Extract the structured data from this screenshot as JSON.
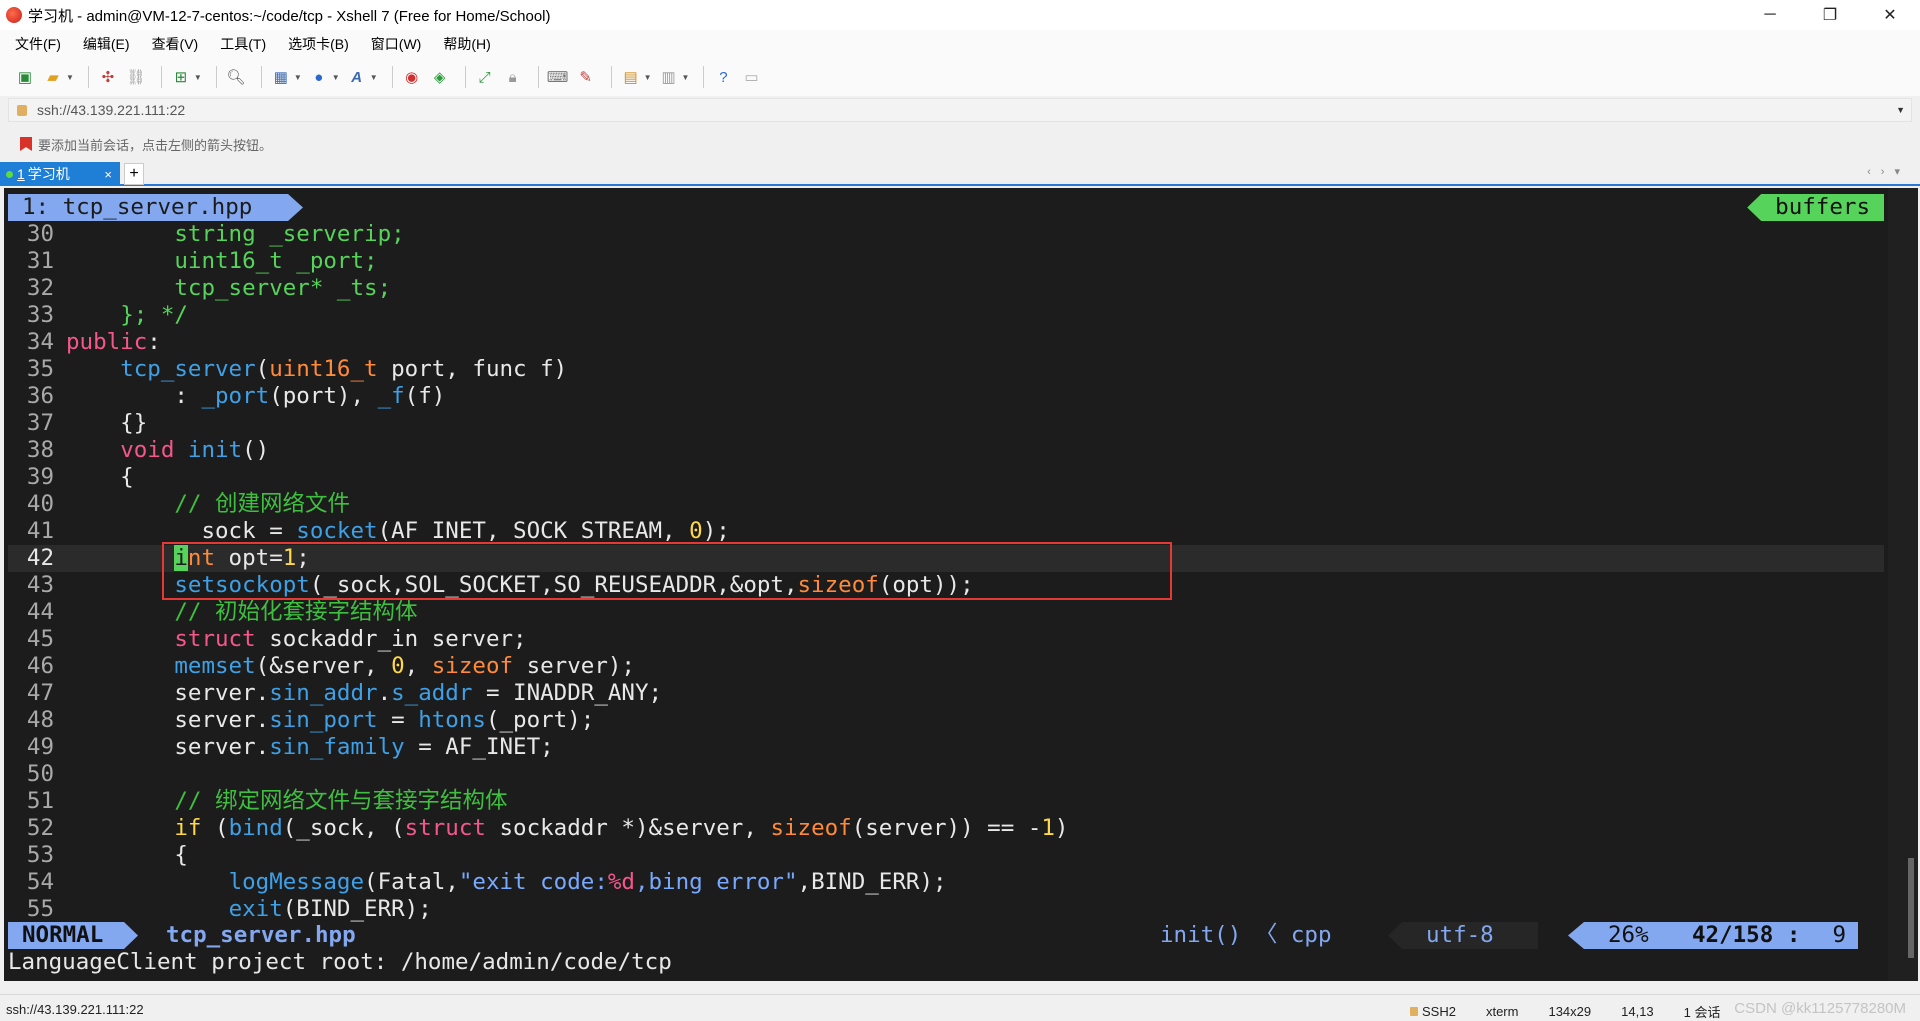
{
  "window": {
    "title": "学习机 - admin@VM-12-7-centos:~/code/tcp - Xshell 7 (Free for Home/School)",
    "minimize": "─",
    "maximize": "❐",
    "close": "✕"
  },
  "menu": [
    "文件(F)",
    "编辑(E)",
    "查看(V)",
    "工具(T)",
    "选项卡(B)",
    "窗口(W)",
    "帮助(H)"
  ],
  "address": {
    "value": "ssh://43.139.221.111:22"
  },
  "hint": {
    "text": "要添加当前会话，点击左侧的箭头按钮。"
  },
  "tab": {
    "number": "1",
    "label": "学习机",
    "close": "×",
    "add": "+"
  },
  "vim": {
    "buffer_file": "1: tcp_server.hpp",
    "buffer_tag": "buffers",
    "current_line": "42",
    "lines": [
      {
        "n": "30",
        "segs": [
          [
            "        ",
            ""
          ],
          [
            "string _serverip;",
            "green"
          ]
        ]
      },
      {
        "n": "31",
        "segs": [
          [
            "        ",
            ""
          ],
          [
            "uint16_t _port;",
            "green"
          ]
        ]
      },
      {
        "n": "32",
        "segs": [
          [
            "        ",
            ""
          ],
          [
            "tcp_server* _ts;",
            "green"
          ]
        ]
      },
      {
        "n": "33",
        "segs": [
          [
            "    ",
            ""
          ],
          [
            "}; */",
            "green"
          ]
        ]
      },
      {
        "n": "34",
        "segs": [
          [
            "public",
            "pink"
          ],
          [
            ":",
            ""
          ]
        ]
      },
      {
        "n": "35",
        "segs": [
          [
            "    ",
            ""
          ],
          [
            "tcp_server",
            "blue"
          ],
          [
            "(",
            ""
          ],
          [
            "uint16_t",
            "orange"
          ],
          [
            " port, func f)",
            ""
          ]
        ]
      },
      {
        "n": "36",
        "segs": [
          [
            "        : ",
            ""
          ],
          [
            "_port",
            "blue"
          ],
          [
            "(port), ",
            ""
          ],
          [
            "_f",
            "blue"
          ],
          [
            "(f)",
            ""
          ]
        ]
      },
      {
        "n": "37",
        "segs": [
          [
            "    {}",
            ""
          ]
        ]
      },
      {
        "n": "38",
        "segs": [
          [
            "    ",
            ""
          ],
          [
            "void",
            "pink"
          ],
          [
            " ",
            ""
          ],
          [
            "init",
            "blue"
          ],
          [
            "()",
            ""
          ]
        ]
      },
      {
        "n": "39",
        "segs": [
          [
            "    {",
            ""
          ]
        ]
      },
      {
        "n": "40",
        "segs": [
          [
            "        ",
            ""
          ],
          [
            "// 创建网络文件",
            "cmt"
          ]
        ]
      },
      {
        "n": "41",
        "segs": [
          [
            "         _sock = ",
            ""
          ],
          [
            "socket",
            "blue"
          ],
          [
            "(AF_INET, SOCK_STREAM, ",
            ""
          ],
          [
            "0",
            "num"
          ],
          [
            ");",
            ""
          ]
        ]
      },
      {
        "n": "42",
        "segs": [
          [
            "        ",
            ""
          ],
          [
            "i",
            "cursor"
          ],
          [
            "nt",
            "orange"
          ],
          [
            " opt=",
            ""
          ],
          [
            "1",
            "num"
          ],
          [
            ";",
            ""
          ]
        ]
      },
      {
        "n": "43",
        "segs": [
          [
            "        ",
            ""
          ],
          [
            "setsockopt",
            "blue"
          ],
          [
            "(_sock,SOL_SOCKET,SO_REUSEADDR,&opt,",
            ""
          ],
          [
            "sizeof",
            "orange"
          ],
          [
            "(opt));",
            ""
          ]
        ]
      },
      {
        "n": "44",
        "segs": [
          [
            "        ",
            ""
          ],
          [
            "// 初始化套接字结构体",
            "cmt"
          ]
        ]
      },
      {
        "n": "45",
        "segs": [
          [
            "        ",
            ""
          ],
          [
            "struct",
            "pink"
          ],
          [
            " sockaddr_in server;",
            ""
          ]
        ]
      },
      {
        "n": "46",
        "segs": [
          [
            "        ",
            ""
          ],
          [
            "memset",
            "blue"
          ],
          [
            "(&server, ",
            ""
          ],
          [
            "0",
            "num"
          ],
          [
            ", ",
            ""
          ],
          [
            "sizeof",
            "orange"
          ],
          [
            " server);",
            ""
          ]
        ]
      },
      {
        "n": "47",
        "segs": [
          [
            "        server.",
            ""
          ],
          [
            "sin_addr",
            "blue"
          ],
          [
            ".",
            ""
          ],
          [
            "s_addr",
            "blue"
          ],
          [
            " = INADDR_ANY;",
            ""
          ]
        ]
      },
      {
        "n": "48",
        "segs": [
          [
            "        server.",
            ""
          ],
          [
            "sin_port",
            "blue"
          ],
          [
            " = ",
            ""
          ],
          [
            "htons",
            "blue"
          ],
          [
            "(_port);",
            ""
          ]
        ]
      },
      {
        "n": "49",
        "segs": [
          [
            "        server.",
            ""
          ],
          [
            "sin_family",
            "blue"
          ],
          [
            " = AF_INET;",
            ""
          ]
        ]
      },
      {
        "n": "50",
        "segs": [
          [
            "",
            ""
          ]
        ]
      },
      {
        "n": "51",
        "segs": [
          [
            "        ",
            ""
          ],
          [
            "// 绑定网络文件与套接字结构体",
            "cmt"
          ]
        ]
      },
      {
        "n": "52",
        "segs": [
          [
            "        ",
            ""
          ],
          [
            "if",
            "yellow"
          ],
          [
            " (",
            ""
          ],
          [
            "bind",
            "blue"
          ],
          [
            "(_sock, (",
            ""
          ],
          [
            "struct",
            "pink"
          ],
          [
            " sockaddr *)&server, ",
            ""
          ],
          [
            "sizeof",
            "orange"
          ],
          [
            "(server)) == -",
            ""
          ],
          [
            "1",
            "num"
          ],
          [
            ")",
            ""
          ]
        ]
      },
      {
        "n": "53",
        "segs": [
          [
            "        {",
            ""
          ]
        ]
      },
      {
        "n": "54",
        "segs": [
          [
            "            ",
            ""
          ],
          [
            "logMessage",
            "blue"
          ],
          [
            "(Fatal,",
            ""
          ],
          [
            "\"exit code:",
            "str"
          ],
          [
            "%d",
            "pink"
          ],
          [
            ",bing error\"",
            "str"
          ],
          [
            ",BIND_ERR);",
            ""
          ]
        ]
      },
      {
        "n": "55",
        "segs": [
          [
            "            ",
            ""
          ],
          [
            "exit",
            "blue"
          ],
          [
            "(BIND_ERR);",
            ""
          ]
        ]
      }
    ],
    "status": {
      "mode": "NORMAL",
      "file": "tcp_server.hpp",
      "func": "init() 〈 cpp",
      "encoding": "utf-8",
      "percent": "26%",
      "line_count": "42/158",
      "sep": ":",
      "col": "9"
    },
    "message": "LanguageClient project root: /home/admin/code/tcp"
  },
  "statusbar": {
    "address": "ssh://43.139.221.111:22",
    "protocol": "SSH2",
    "term": "xterm",
    "size": "134x29",
    "cursor": "14,13",
    "sessions": "1 会话",
    "watermark": "CSDN @kk1125778280M"
  },
  "colors": {
    "terminal_bg": "#1c1c1c",
    "accent_blue": "#84a8f0",
    "accent_green": "#56d35a",
    "tab_blue": "#1f7ed6",
    "highlight_red": "#e53935"
  }
}
